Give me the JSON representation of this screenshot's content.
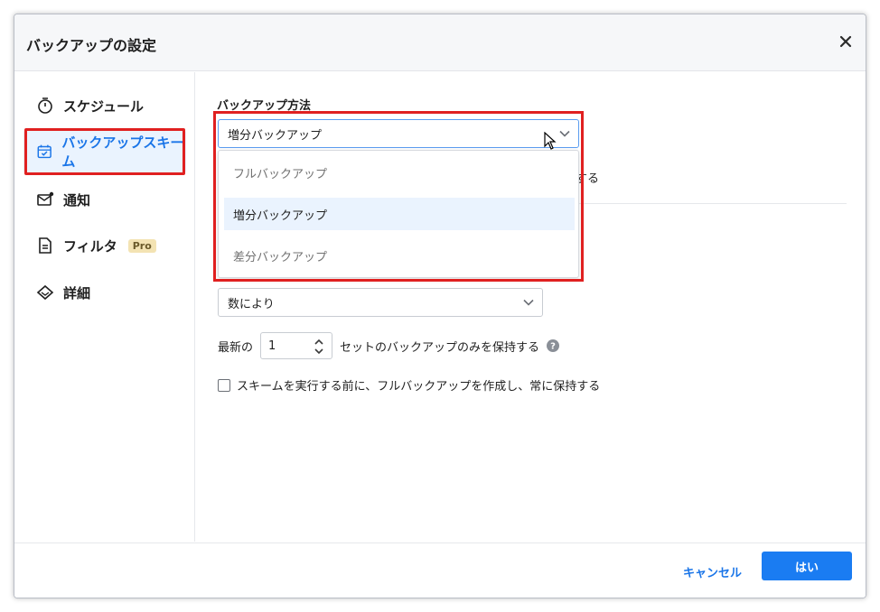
{
  "dialog": {
    "title": "バックアップの設定",
    "close_icon": "close-icon"
  },
  "sidebar": {
    "items": [
      {
        "label": "スケジュール",
        "icon": "timer-icon"
      },
      {
        "label": "バックアップスキーム",
        "icon": "calendar-check-icon",
        "active": true
      },
      {
        "label": "通知",
        "icon": "mail-notification-icon"
      },
      {
        "label": "フィルタ",
        "icon": "document-icon",
        "badge": "Pro"
      },
      {
        "label": "詳細",
        "icon": "diamond-icon"
      }
    ]
  },
  "main": {
    "backup_method_label": "バックアップ方法",
    "backup_method_value": "増分バックアップ",
    "dropdown_options": [
      "フルバックアップ",
      "増分バックアップ",
      "差分バックアップ"
    ],
    "selected_option": "増分バックアップ",
    "obscured_text_fragment": "する",
    "cleanup_value": "数により",
    "keep_prefix": "最新の",
    "keep_count": "1",
    "keep_suffix": "セットのバックアップのみを保持する",
    "full_backup_checkbox_label": "スキームを実行する前に、フルバックアップを作成し、常に保持する",
    "full_backup_checked": false
  },
  "footer": {
    "cancel_label": "キャンセル",
    "ok_label": "はい"
  },
  "colors": {
    "accent": "#1a7cf2",
    "active_bg": "#eaf3fe",
    "highlight_red": "#e02020"
  }
}
